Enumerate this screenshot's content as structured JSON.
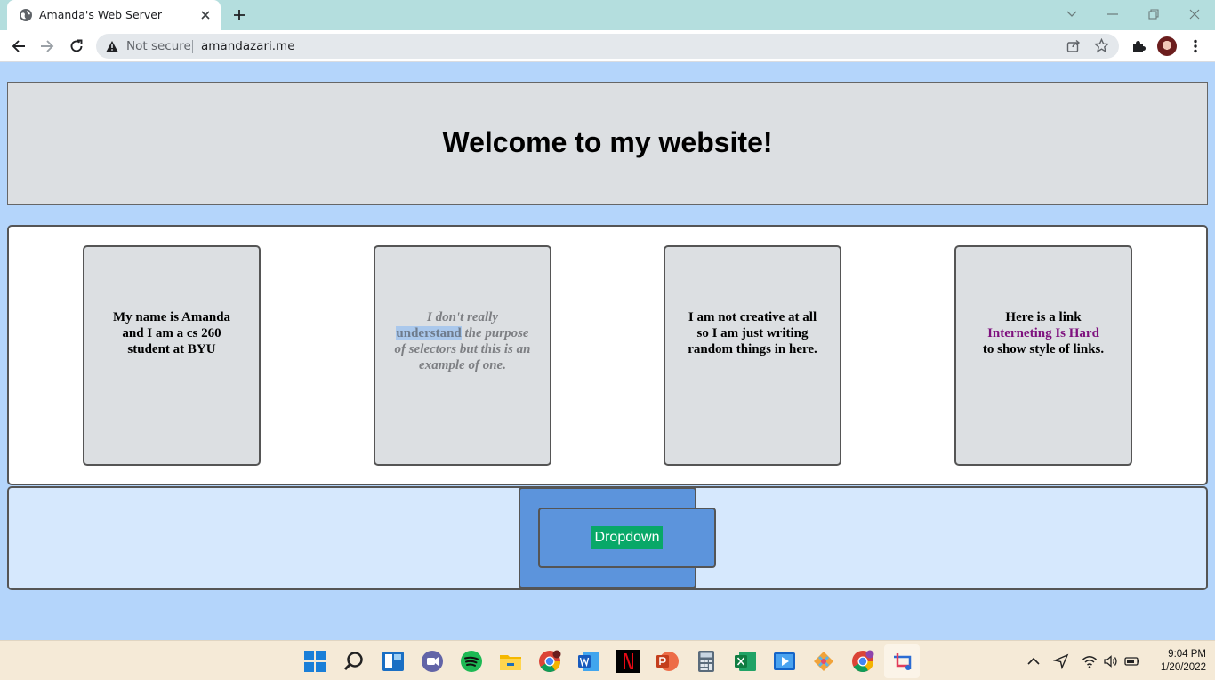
{
  "browser": {
    "tab_title": "Amanda's Web Server",
    "security_label": "Not secure",
    "url": "amandazari.me"
  },
  "page": {
    "heading": "Welcome to my website!",
    "cards": [
      {
        "text": "My name is Amanda and I am a cs 260 student at BYU"
      },
      {
        "text_before": "I don't really",
        "highlighted": "understand",
        "text_after": "the purpose of selectors but this is an example of one."
      },
      {
        "text": "I am not creative at all so I am just writing random things in here."
      },
      {
        "text_before": "Here is a link",
        "link_text": "Interneting Is Hard",
        "text_after": "to show style of links."
      }
    ],
    "dropdown_label": "Dropdown"
  },
  "taskbar": {
    "time": "9:04 PM",
    "date": "1/20/2022",
    "icons": [
      "windows-start",
      "search",
      "widgets",
      "teams-chat",
      "spotify",
      "file-explorer",
      "chrome",
      "word",
      "netflix",
      "powerpoint",
      "calculator",
      "excel",
      "media-player",
      "sourcetree",
      "chrome-profile",
      "snipping-tool"
    ]
  },
  "colors": {
    "page_background": "#b4d5fb",
    "panel_gray": "#dcdfe2",
    "footer_background": "#d6e8fd",
    "dropdown_box": "#5c94dc",
    "dropdown_button": "#08a868",
    "link_color": "#7e107e",
    "tabbar": "#b4dede"
  }
}
